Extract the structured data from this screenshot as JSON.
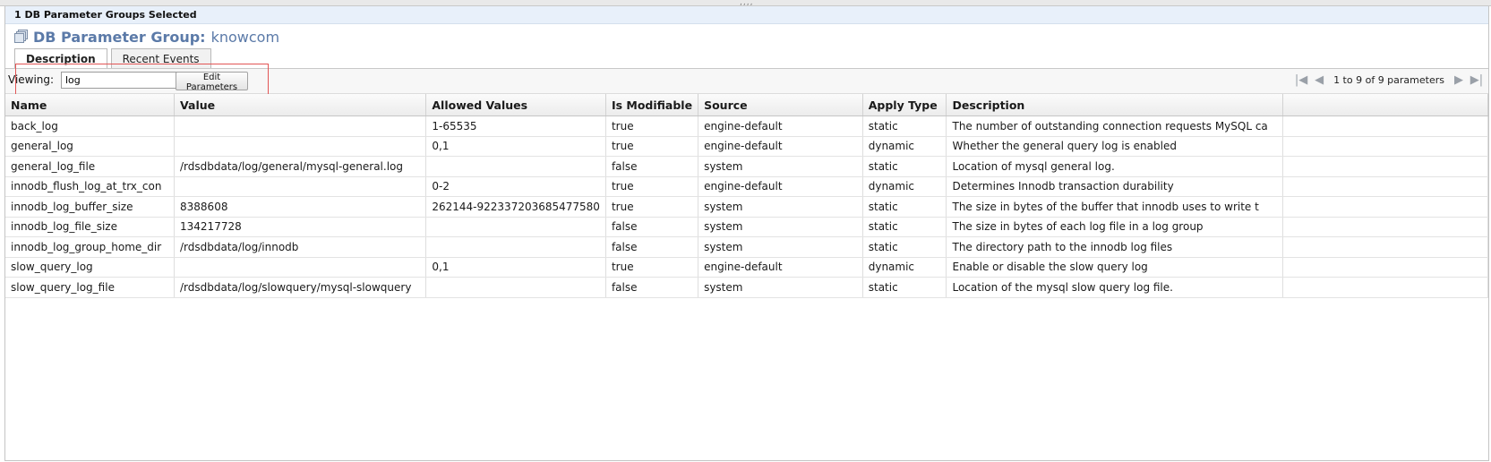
{
  "header": {
    "selection": "1 DB Parameter Groups Selected",
    "title_label": "DB Parameter Group:",
    "title_value": "knowcom"
  },
  "tabs": [
    {
      "label": "Description"
    },
    {
      "label": "Recent Events"
    }
  ],
  "toolbar": {
    "viewing_label": "Viewing:",
    "viewing_value": "log",
    "edit_button": "Edit Parameters"
  },
  "pager": {
    "text": "1 to 9 of 9 parameters"
  },
  "table": {
    "columns": [
      "Name",
      "Value",
      "Allowed Values",
      "Is Modifiable",
      "Source",
      "Apply Type",
      "Description",
      ""
    ],
    "rows": [
      [
        "back_log",
        "",
        "1-65535",
        "true",
        "engine-default",
        "static",
        "The number of outstanding connection requests MySQL ca",
        ""
      ],
      [
        "general_log",
        "",
        "0,1",
        "true",
        "engine-default",
        "dynamic",
        "Whether the general query log is enabled",
        ""
      ],
      [
        "general_log_file",
        "/rdsdbdata/log/general/mysql-general.log",
        "",
        "false",
        "system",
        "static",
        "Location of mysql general log.",
        ""
      ],
      [
        "innodb_flush_log_at_trx_con",
        "",
        "0-2",
        "true",
        "engine-default",
        "dynamic",
        "Determines Innodb transaction durability",
        ""
      ],
      [
        "innodb_log_buffer_size",
        "8388608",
        "262144-922337203685477580",
        "true",
        "system",
        "static",
        "The size in bytes of the buffer that innodb uses to write t",
        ""
      ],
      [
        "innodb_log_file_size",
        "134217728",
        "",
        "false",
        "system",
        "static",
        "The size in bytes of each log file in a log group",
        ""
      ],
      [
        "innodb_log_group_home_dir",
        "/rdsdbdata/log/innodb",
        "",
        "false",
        "system",
        "static",
        "The directory path to the innodb log files",
        ""
      ],
      [
        "slow_query_log",
        "",
        "0,1",
        "true",
        "engine-default",
        "dynamic",
        "Enable or disable the slow query log",
        ""
      ],
      [
        "slow_query_log_file",
        "/rdsdbdata/log/slowquery/mysql-slowquery",
        "",
        "false",
        "system",
        "static",
        "Location of the mysql slow query log file.",
        ""
      ]
    ]
  },
  "colors": {
    "title": "#5b7aa8",
    "selection_bar": "#e8f0fa",
    "highlight": "#e25555"
  }
}
